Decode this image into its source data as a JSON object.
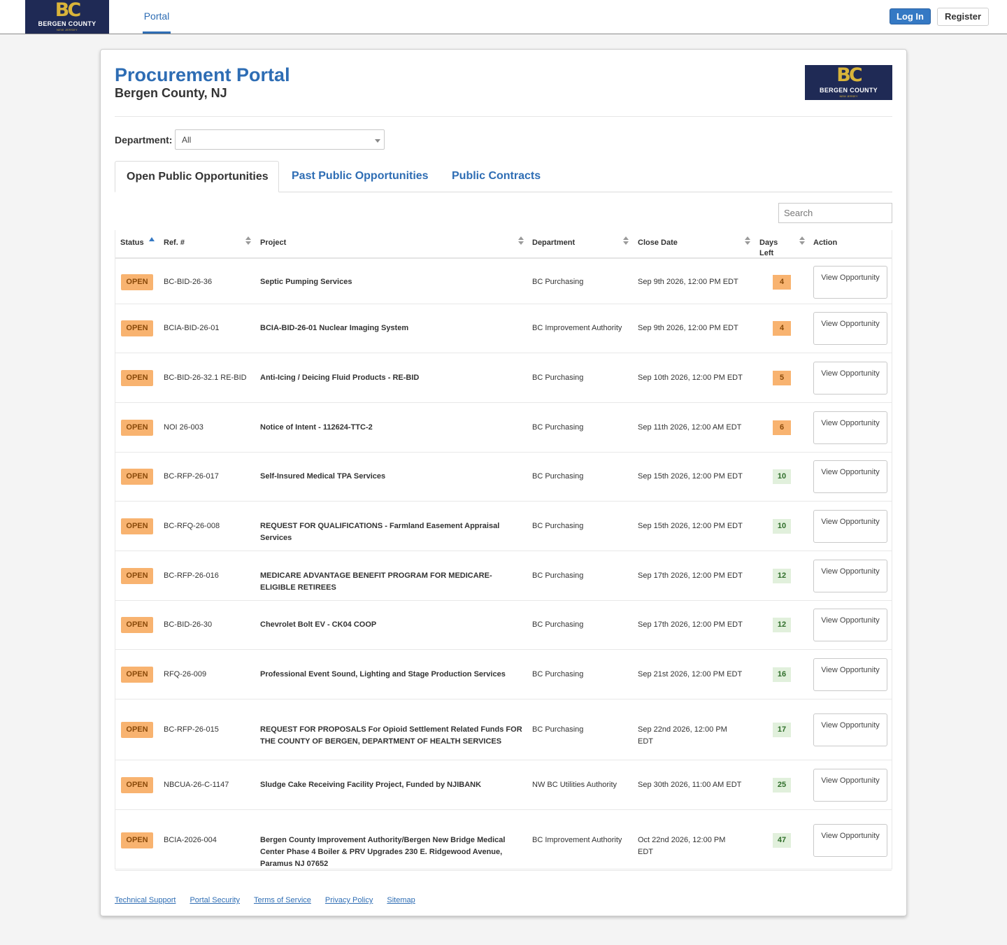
{
  "nav": {
    "logo": {
      "mark": "BC",
      "name": "BERGEN COUNTY",
      "sub": "NEW JERSEY"
    },
    "tab": "Portal",
    "login": "Log In",
    "register": "Register"
  },
  "header": {
    "title": "Procurement Portal",
    "subtitle": "Bergen County, NJ",
    "logo": {
      "mark": "BC",
      "name": "BERGEN COUNTY",
      "sub": "NEW JERSEY"
    }
  },
  "filter": {
    "label": "Department:",
    "value": "All"
  },
  "tabs": [
    {
      "label": "Open Public Opportunities",
      "active": true
    },
    {
      "label": "Past Public Opportunities",
      "active": false
    },
    {
      "label": "Public Contracts",
      "active": false
    }
  ],
  "search": {
    "placeholder": "Search"
  },
  "colors": {
    "accent": "#2e6db4",
    "open_badge": "#f8b370",
    "days_ok": "#e1f0dc",
    "logo_bg": "#1f2a55",
    "logo_gold": "#d9b43a"
  },
  "table": {
    "columns": [
      "Status",
      "Ref. #",
      "Project",
      "Department",
      "Close Date",
      "Days Left",
      "Action"
    ],
    "rows": [
      {
        "status": "OPEN",
        "ref": "BC-BID-26-36",
        "project": "Septic Pumping Services",
        "department": "BC Purchasing",
        "close_date": "Sep 9th 2026, 12:00 PM EDT",
        "days_left": "4",
        "action": "View Opportunity"
      },
      {
        "status": "OPEN",
        "ref": "BCIA-BID-26-01",
        "project": "BCIA-BID-26-01 Nuclear Imaging System",
        "department": "BC Improvement Authority",
        "close_date": "Sep 9th 2026, 12:00 PM EDT",
        "days_left": "4",
        "action": "View Opportunity"
      },
      {
        "status": "OPEN",
        "ref": "BC-BID-26-32.1 RE-BID",
        "project": "Anti-Icing / Deicing Fluid Products - RE-BID",
        "department": "BC Purchasing",
        "close_date": "Sep 10th 2026, 12:00 PM EDT",
        "days_left": "5",
        "action": "View Opportunity"
      },
      {
        "status": "OPEN",
        "ref": "NOI 26-003",
        "project": "Notice of Intent - 112624-TTC-2",
        "department": "BC Purchasing",
        "close_date": "Sep 11th 2026, 12:00 AM EDT",
        "days_left": "6",
        "action": "View Opportunity"
      },
      {
        "status": "OPEN",
        "ref": "BC-RFP-26-017",
        "project": "Self-Insured Medical TPA Services",
        "department": "BC Purchasing",
        "close_date": "Sep 15th 2026, 12:00 PM EDT",
        "days_left": "10",
        "action": "View Opportunity"
      },
      {
        "status": "OPEN",
        "ref": "BC-RFQ-26-008",
        "project": "REQUEST FOR QUALIFICATIONS - Farmland Easement Appraisal Services",
        "department": "BC Purchasing",
        "close_date": "Sep 15th 2026, 12:00 PM EDT",
        "days_left": "10",
        "action": "View Opportunity"
      },
      {
        "status": "OPEN",
        "ref": "BC-RFP-26-016",
        "project": "MEDICARE ADVANTAGE BENEFIT PROGRAM FOR MEDICARE-ELIGIBLE RETIREES",
        "department": "BC Purchasing",
        "close_date": "Sep 17th 2026, 12:00 PM EDT",
        "days_left": "12",
        "action": "View Opportunity"
      },
      {
        "status": "OPEN",
        "ref": "BC-BID-26-30",
        "project": "Chevrolet Bolt EV - CK04 COOP",
        "department": "BC Purchasing",
        "close_date": "Sep 17th 2026, 12:00 PM EDT",
        "days_left": "12",
        "action": "View Opportunity"
      },
      {
        "status": "OPEN",
        "ref": "RFQ-26-009",
        "project": "Professional Event Sound, Lighting and Stage Production Services",
        "department": "BC Purchasing",
        "close_date": "Sep 21st 2026, 12:00 PM EDT",
        "days_left": "16",
        "action": "View Opportunity"
      },
      {
        "status": "OPEN",
        "ref": "BC-RFP-26-015",
        "project": "REQUEST FOR PROPOSALS For Opioid Settlement Related Funds FOR THE COUNTY OF BERGEN, DEPARTMENT OF HEALTH SERVICES",
        "department": "BC Purchasing",
        "close_date": "Sep 22nd 2026, 12:00 PM EDT",
        "days_left": "17",
        "action": "View Opportunity"
      },
      {
        "status": "OPEN",
        "ref": "NBCUA-26-C-1147",
        "project": "Sludge Cake Receiving Facility Project, Funded by NJIBANK",
        "department": "NW BC Utilities Authority",
        "close_date": "Sep 30th 2026, 11:00 AM EDT",
        "days_left": "25",
        "action": "View Opportunity"
      },
      {
        "status": "OPEN",
        "ref": "BCIA-2026-004",
        "project": "Bergen County Improvement Authority/Bergen New Bridge Medical Center Phase 4 Boiler & PRV Upgrades 230 E. Ridgewood Avenue, Paramus NJ 07652",
        "department": "BC Improvement Authority",
        "close_date": "Oct 22nd 2026, 12:00 PM EDT",
        "days_left": "47",
        "action": "View Opportunity"
      }
    ]
  },
  "footer": {
    "links": [
      "Technical Support",
      "Portal Security",
      "Terms of Service",
      "Privacy Policy",
      "Sitemap"
    ]
  }
}
